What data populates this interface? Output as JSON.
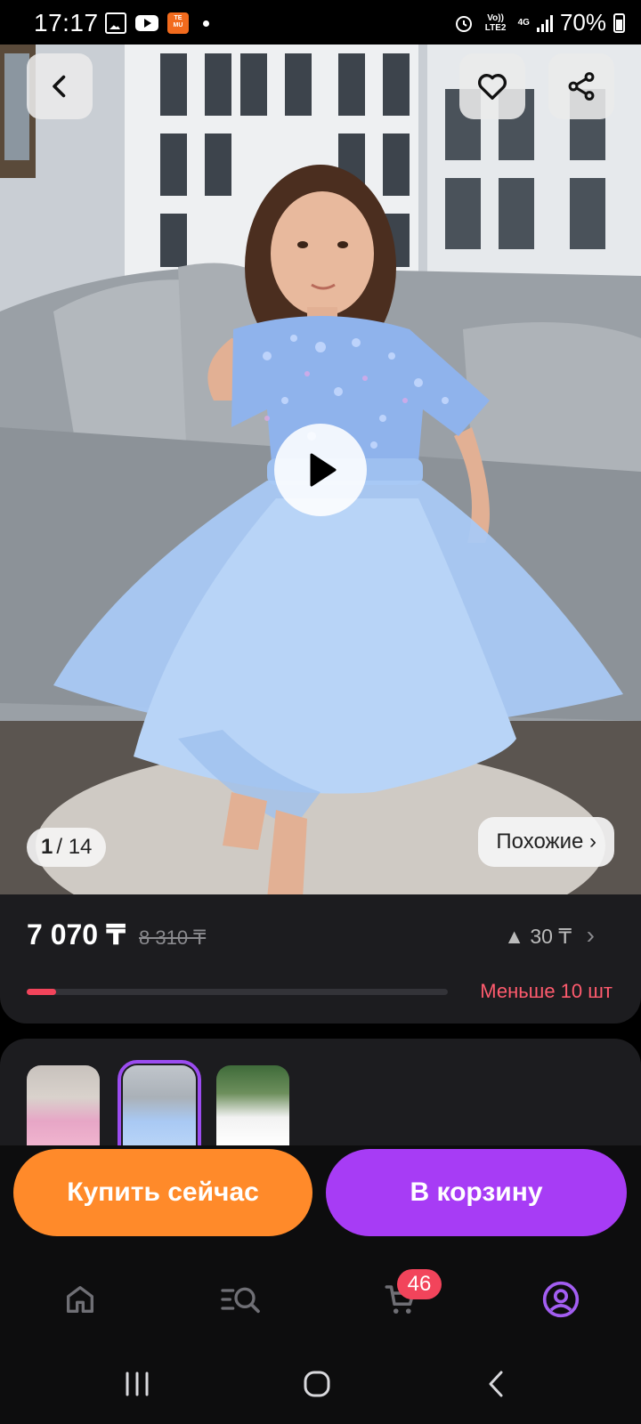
{
  "status_bar": {
    "time": "17:17",
    "temu_label": "TEMU",
    "volte": "Vo)) LTE2",
    "network": "4G",
    "battery": "70%"
  },
  "product": {
    "image_counter_current": "1",
    "image_counter_total": "/ 14",
    "similar_label": "Похожие ›",
    "price": "7 070 ₸",
    "old_price": "8 310 ₸",
    "price_drop": "▲ 30 ₸",
    "stock_text": "Меньше 10 шт",
    "stock_level": 0.07,
    "thumbnail_colors": [
      "pink",
      "blue",
      "white"
    ],
    "selected_thumbnail": 1
  },
  "actions": {
    "buy_now": "Купить сейчас",
    "add_to_cart": "В корзину"
  },
  "tabbar": {
    "cart_badge": "46",
    "items": [
      "home-icon",
      "catalog-search-icon",
      "cart-icon",
      "profile-icon"
    ],
    "active": "profile-icon"
  },
  "colors": {
    "buy": "#ff8a2a",
    "cart": "#a73cf5",
    "accent_red": "#f2445b",
    "active_tab": "#a35ef2"
  }
}
